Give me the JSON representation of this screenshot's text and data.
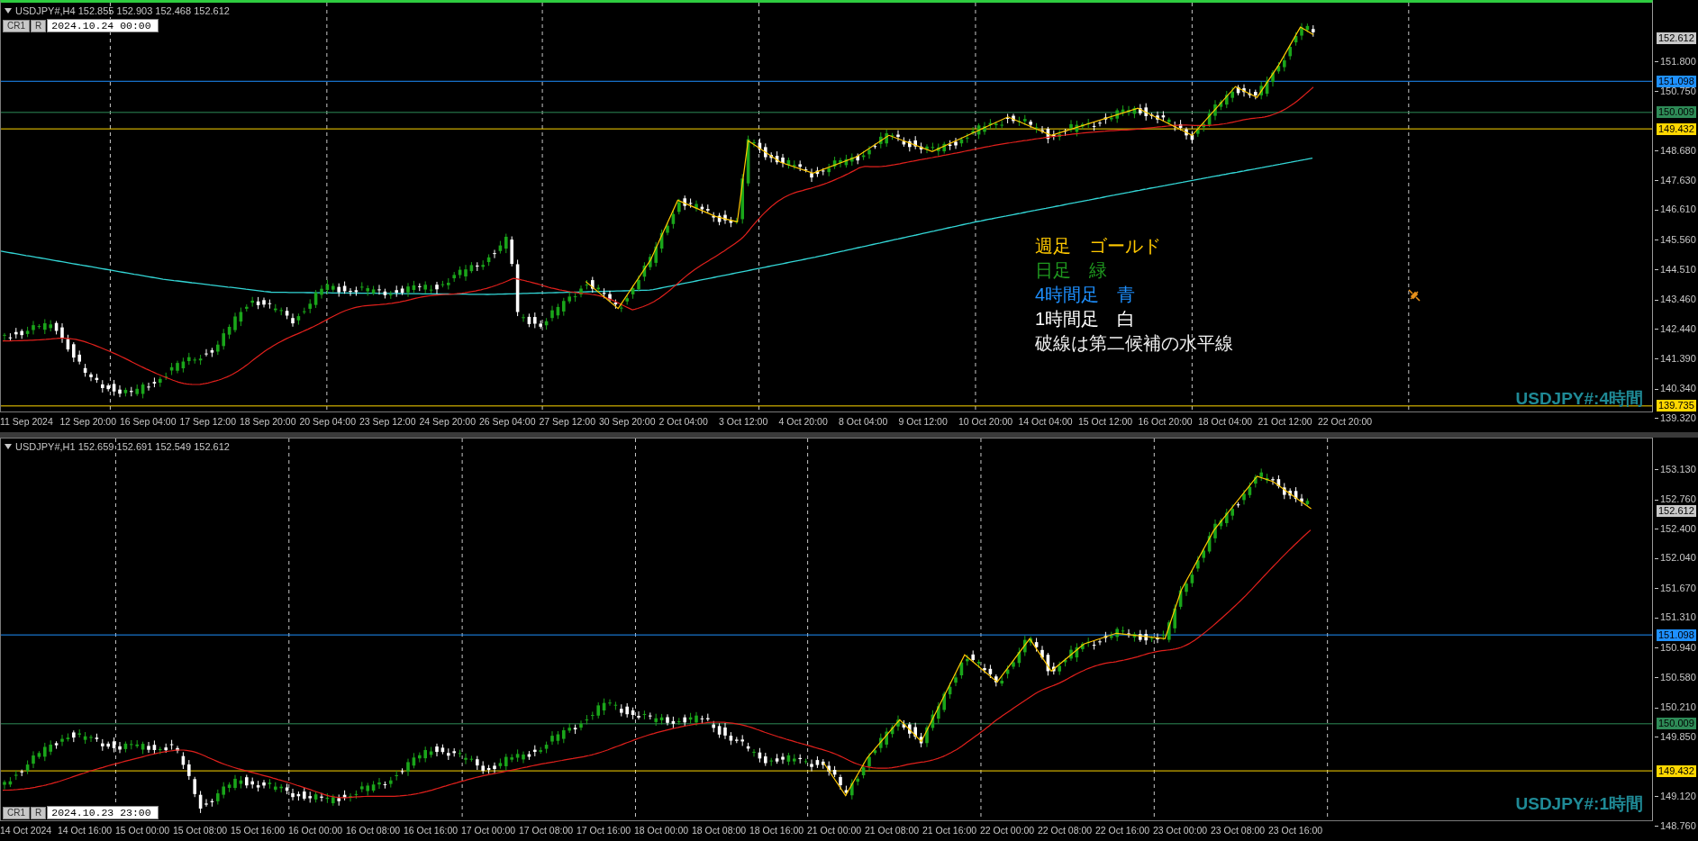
{
  "charts": [
    {
      "active": true,
      "symbol_line": "USDJPY#,H4  152.855 152.903 152.468 152.612",
      "buttons": [
        "CR1",
        "R"
      ],
      "time_field": "2024.10.24 00:00",
      "label": "USDJPY#:4時間",
      "price_ticks": [
        "151.800",
        "150.750",
        "148.680",
        "147.630",
        "146.610",
        "145.560",
        "144.510",
        "143.460",
        "142.440",
        "141.390",
        "140.340",
        "139.320"
      ],
      "current_price": "152.612",
      "levels": [
        {
          "price": "151.098",
          "color": "#1e90ff"
        },
        {
          "price": "150.009",
          "color": "#2e8b57"
        },
        {
          "price": "149.432",
          "color": "#ffd700"
        },
        {
          "price": "139.735",
          "color": "#ffd700"
        }
      ],
      "time_labels": [
        "11 Sep 2024",
        "12 Sep 20:00",
        "16 Sep 04:00",
        "17 Sep 12:00",
        "18 Sep 20:00",
        "20 Sep 04:00",
        "23 Sep 12:00",
        "24 Sep 20:00",
        "26 Sep 04:00",
        "27 Sep 12:00",
        "30 Sep 20:00",
        "2 Oct 04:00",
        "3 Oct 12:00",
        "4 Oct 20:00",
        "8 Oct 04:00",
        "9 Oct 12:00",
        "10 Oct 20:00",
        "14 Oct 04:00",
        "15 Oct 12:00",
        "16 Oct 20:00",
        "18 Oct 04:00",
        "21 Oct 12:00",
        "22 Oct 20:00"
      ],
      "notes": [
        {
          "text": "週足　ゴールド",
          "color": "#ffc800"
        },
        {
          "text": "日足　緑",
          "color": "#1f9a1f"
        },
        {
          "text": "4時間足　青",
          "color": "#1e90ff"
        },
        {
          "text": "1時間足　白",
          "color": "#ffffff"
        },
        {
          "text": "破線は第二候補の水平線",
          "color": "#f0f0f0"
        }
      ]
    },
    {
      "active": false,
      "symbol_line": "USDJPY#,H1  152.659 152.691 152.549 152.612",
      "buttons": [
        "CR1",
        "R"
      ],
      "time_field": "2024.10.23 23:00",
      "label": "USDJPY#:1時間",
      "price_ticks": [
        "153.130",
        "152.760",
        "152.400",
        "152.040",
        "151.670",
        "151.310",
        "150.940",
        "150.580",
        "150.210",
        "149.850",
        "149.120",
        "148.760"
      ],
      "current_price": "152.612",
      "levels": [
        {
          "price": "151.098",
          "color": "#1e90ff"
        },
        {
          "price": "150.009",
          "color": "#2e8b57"
        },
        {
          "price": "149.432",
          "color": "#ffd700"
        }
      ],
      "time_labels": [
        "14 Oct 2024",
        "14 Oct 16:00",
        "15 Oct 00:00",
        "15 Oct 08:00",
        "15 Oct 16:00",
        "16 Oct 00:00",
        "16 Oct 08:00",
        "16 Oct 16:00",
        "17 Oct 00:00",
        "17 Oct 08:00",
        "17 Oct 16:00",
        "18 Oct 00:00",
        "18 Oct 08:00",
        "18 Oct 16:00",
        "21 Oct 00:00",
        "21 Oct 08:00",
        "21 Oct 16:00",
        "22 Oct 00:00",
        "22 Oct 08:00",
        "22 Oct 16:00",
        "23 Oct 00:00",
        "23 Oct 08:00",
        "23 Oct 16:00"
      ]
    }
  ]
}
